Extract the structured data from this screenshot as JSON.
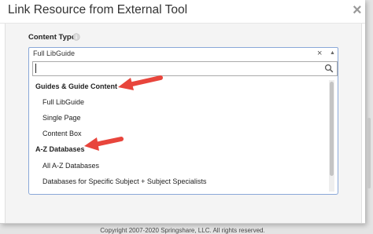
{
  "dialog": {
    "title": "Link Resource from External Tool",
    "close_glyph": "×"
  },
  "field": {
    "label": "Content Type",
    "info_icon": "info-circle-icon"
  },
  "select": {
    "value": "Full LibGuide",
    "clear_glyph": "×",
    "caret_glyph": "▲"
  },
  "dropdown": {
    "search_value": "",
    "search_icon": "magnifier-icon",
    "groups": [
      {
        "label": "Guides & Guide Content",
        "items": [
          "Full LibGuide",
          "Single Page",
          "Content Box"
        ]
      },
      {
        "label": "A-Z Databases",
        "items": [
          "All A-Z Databases",
          "Databases for Specific Subject + Subject Specialists"
        ]
      }
    ]
  },
  "annotations": {
    "arrow_color": "#e8453c"
  },
  "footer": {
    "copyright": "Copyright 2007-2020 Springshare, LLC. All rights reserved."
  }
}
